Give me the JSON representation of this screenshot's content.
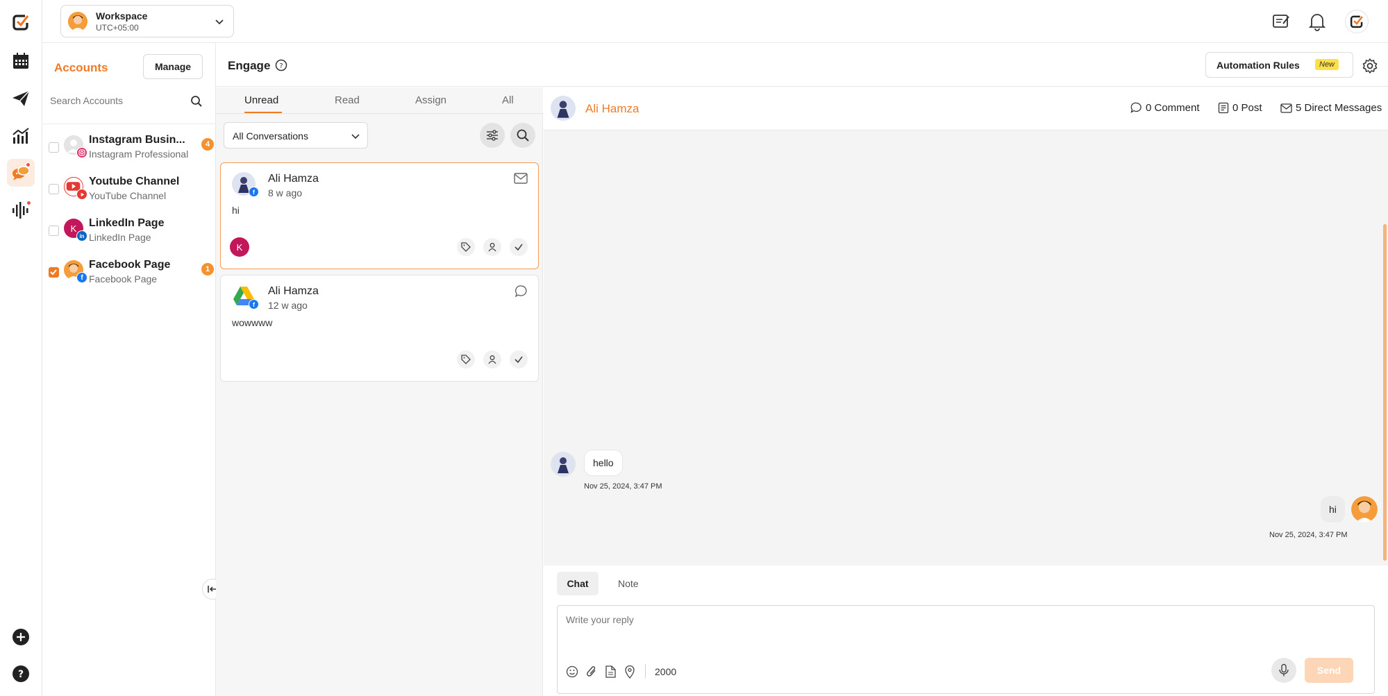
{
  "workspace": {
    "name": "Workspace",
    "timezone": "UTC+05:00"
  },
  "accounts_panel": {
    "title": "Accounts",
    "manage_label": "Manage",
    "search_placeholder": "Search Accounts",
    "items": [
      {
        "name": "Instagram Busin...",
        "type": "Instagram Professional",
        "checked": false,
        "badge": "4"
      },
      {
        "name": "Youtube Channel",
        "type": "YouTube Channel",
        "checked": false
      },
      {
        "name": "LinkedIn Page",
        "type": "LinkedIn Page",
        "checked": false,
        "avatar_letter": "K"
      },
      {
        "name": "Facebook Page",
        "type": "Facebook Page",
        "checked": true,
        "badge": "1"
      }
    ]
  },
  "engage": {
    "title": "Engage",
    "automation_label": "Automation Rules",
    "new_badge": "New"
  },
  "conversations": {
    "tabs": [
      "Unread",
      "Read",
      "Assign",
      "All"
    ],
    "active_tab": "Unread",
    "filter_value": "All Conversations",
    "items": [
      {
        "name": "Ali Hamza",
        "time": "8 w ago",
        "message": "hi",
        "assignee_initial": "K"
      },
      {
        "name": "Ali Hamza",
        "time": "12 w ago",
        "message": "wowwww"
      }
    ]
  },
  "chat": {
    "contact_name": "Ali Hamza",
    "stats": {
      "comments": "0 Comment",
      "posts": "0 Post",
      "dms": "5 Direct Messages"
    },
    "messages": [
      {
        "text": "hello",
        "time": "Nov 25, 2024, 3:47 PM",
        "direction": "in"
      },
      {
        "text": "hi",
        "time": "Nov 25, 2024, 3:47 PM",
        "direction": "out"
      }
    ],
    "composer": {
      "tabs": [
        "Chat",
        "Note"
      ],
      "placeholder": "Write your reply",
      "char_count": "2000",
      "send_label": "Send"
    }
  },
  "colors": {
    "accent": "#f07a24",
    "facebook": "#1877f2"
  }
}
